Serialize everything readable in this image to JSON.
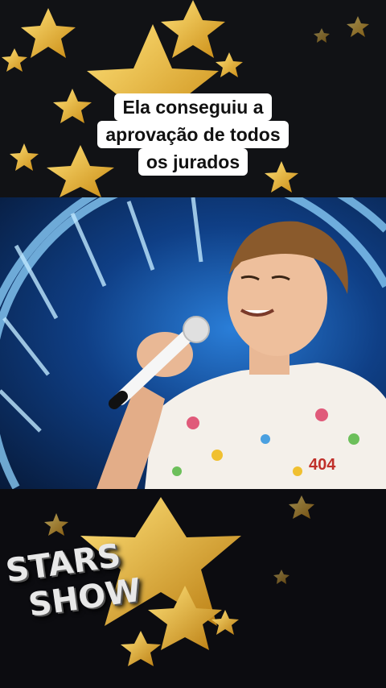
{
  "caption": {
    "line1": "Ela conseguiu a",
    "line2": "aprovação de todos",
    "line3": "os jurados"
  },
  "logo": {
    "line1": "STARS",
    "line2": "SHOW"
  },
  "shirt_text": "404",
  "colors": {
    "star_gold": "#e8b42a",
    "stage_blue": "#1f6fcf",
    "caption_bg": "#ffffff"
  }
}
